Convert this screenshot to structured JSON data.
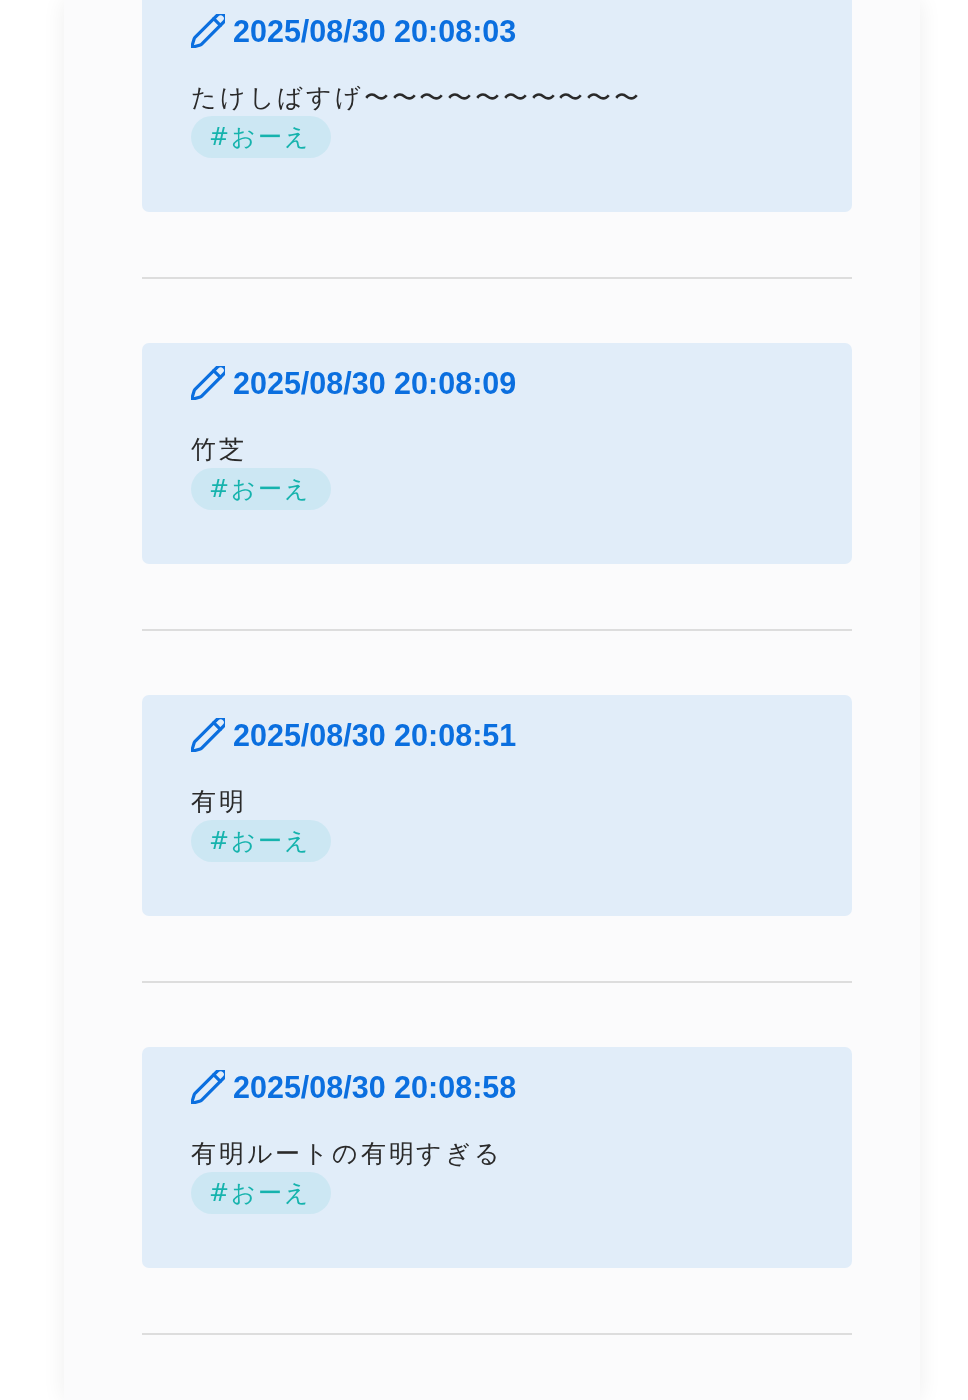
{
  "entries": [
    {
      "timestamp": "2025/08/30 20:08:03",
      "text": "たけしばすげ〜〜〜〜〜〜〜〜〜〜",
      "tags": [
        "#おーえ"
      ]
    },
    {
      "timestamp": "2025/08/30 20:08:09",
      "text": "竹芝",
      "tags": [
        "#おーえ"
      ]
    },
    {
      "timestamp": "2025/08/30 20:08:51",
      "text": "有明",
      "tags": [
        "#おーえ"
      ]
    },
    {
      "timestamp": "2025/08/30 20:08:58",
      "text": "有明ルートの有明すぎる",
      "tags": [
        "#おーえ"
      ]
    }
  ]
}
